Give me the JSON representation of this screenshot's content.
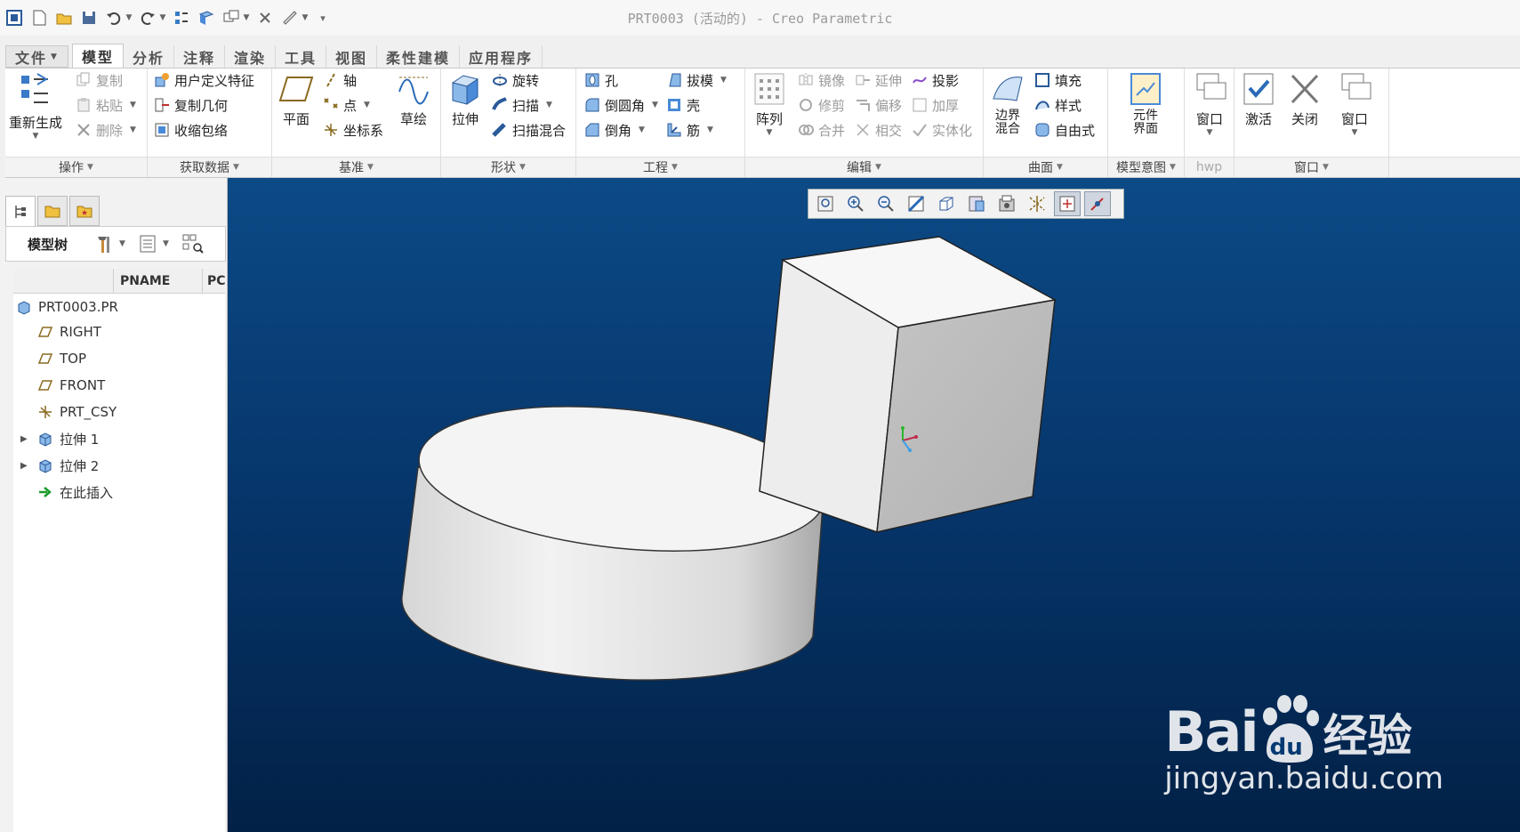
{
  "window": {
    "title": "PRT0003 (活动的) - Creo Parametric"
  },
  "ribbon_tabs": [
    {
      "label": "文件"
    },
    {
      "label": "模型"
    },
    {
      "label": "分析"
    },
    {
      "label": "注释"
    },
    {
      "label": "渲染"
    },
    {
      "label": "工具"
    },
    {
      "label": "视图"
    },
    {
      "label": "柔性建模"
    },
    {
      "label": "应用程序"
    }
  ],
  "groups": {
    "operations": {
      "label": "操作",
      "regenerate": "重新生成",
      "copy": "复制",
      "paste": "粘贴",
      "delete": "删除"
    },
    "get_data": {
      "label": "获取数据",
      "udf": "用户定义特征",
      "copy_geom": "复制几何",
      "shrinkwrap": "收缩包络"
    },
    "datum": {
      "label": "基准",
      "plane": "平面",
      "axis": "轴",
      "point": "点",
      "csys": "坐标系",
      "sketch": "草绘"
    },
    "shapes": {
      "label": "形状",
      "extrude": "拉伸",
      "revolve": "旋转",
      "sweep": "扫描",
      "swept_blend": "扫描混合"
    },
    "engineering": {
      "label": "工程",
      "hole": "孔",
      "round": "倒圆角",
      "chamfer": "倒角",
      "draft": "拔模",
      "shell": "壳",
      "rib": "筋"
    },
    "editing": {
      "label": "编辑",
      "pattern": "阵列",
      "mirror": "镜像",
      "trim": "修剪",
      "merge": "合并",
      "extend": "延伸",
      "offset": "偏移",
      "intersect": "相交",
      "project": "投影",
      "thicken": "加厚",
      "solidify": "实体化"
    },
    "surfaces": {
      "label": "曲面",
      "boundary_blend": "边界混合",
      "fill": "填充",
      "style": "样式",
      "freestyle": "自由式"
    },
    "model_intent": {
      "label": "模型意图",
      "component_interface": "元件界面"
    },
    "hwp": {
      "label": "hwp"
    },
    "window": {
      "label": "窗口",
      "window1": "窗口",
      "activate": "激活",
      "close": "关闭",
      "window2": "窗口"
    }
  },
  "model_tree": {
    "label": "模型树",
    "columns": [
      "PNAME",
      "PC"
    ],
    "items": [
      {
        "label": "PRT0003.PR",
        "icon": "part-icon"
      },
      {
        "label": "RIGHT",
        "icon": "datum-plane-icon"
      },
      {
        "label": "TOP",
        "icon": "datum-plane-icon"
      },
      {
        "label": "FRONT",
        "icon": "datum-plane-icon"
      },
      {
        "label": "PRT_CSY",
        "icon": "csys-icon"
      },
      {
        "label": "拉伸 1",
        "icon": "extrude-icon"
      },
      {
        "label": "拉伸 2",
        "icon": "extrude-icon"
      },
      {
        "label": "在此插入",
        "icon": "insert-arrow-icon"
      }
    ]
  },
  "watermark": {
    "brand": "Bai",
    "brand2": "du",
    "cn": "经验",
    "url": "jingyan.baidu.com"
  },
  "colors": {
    "viewport_top": "#0c4a86",
    "viewport_bottom": "#022146",
    "model_face": "#e8e8e8"
  }
}
